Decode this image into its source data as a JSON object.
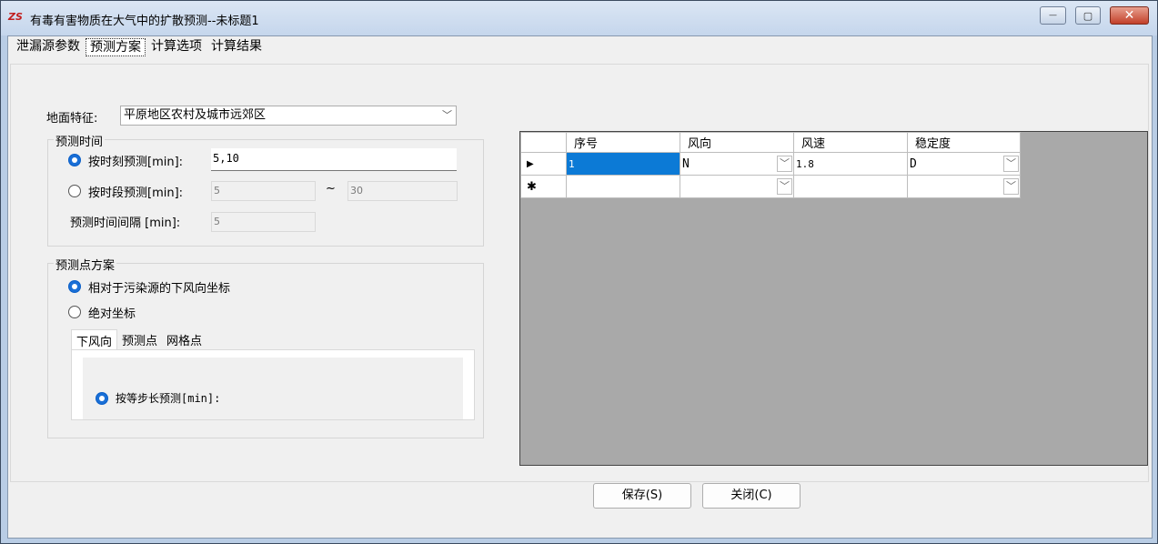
{
  "window": {
    "title": "有毒有害物质在大气中的扩散预测--未标题1",
    "icon_text": "ZS",
    "controls": {
      "minimize": "—",
      "maximize": "▢",
      "close": "✕"
    }
  },
  "menu": {
    "items": [
      {
        "label": "泄漏源参数",
        "active": false
      },
      {
        "label": "预测方案",
        "active": true
      },
      {
        "label": "计算选项",
        "active": false
      },
      {
        "label": "计算结果",
        "active": false
      }
    ]
  },
  "terrain": {
    "label": "地面特征:",
    "value": "平原地区农村及城市远郊区"
  },
  "time_group": {
    "title": "预测时间",
    "by_moment_label": "按时刻预测[min]:",
    "by_moment_value": "5,10",
    "by_period_label": "按时段预测[min]:",
    "period_from": "5",
    "period_tilde": "~",
    "period_to": "30",
    "interval_label": "预测时间间隔 [min]:",
    "interval_value": "5"
  },
  "point_group": {
    "title": "预测点方案",
    "relative_label": "相对于污染源的下风向坐标",
    "absolute_label": "绝对坐标",
    "tabs": [
      "下风向",
      "预测点",
      "网格点"
    ],
    "equal_step_label": "按等步长预测[min]:"
  },
  "grid": {
    "headers": [
      "序号",
      "风向",
      "风速",
      "稳定度"
    ],
    "rows": [
      {
        "marker": "▶",
        "index": "1",
        "direction": "N",
        "speed": "1.8",
        "stability": "D"
      },
      {
        "marker": "✱",
        "index": "",
        "direction": "",
        "speed": "",
        "stability": ""
      }
    ]
  },
  "buttons": {
    "save": "保存(S)",
    "close": "关闭(C)"
  }
}
